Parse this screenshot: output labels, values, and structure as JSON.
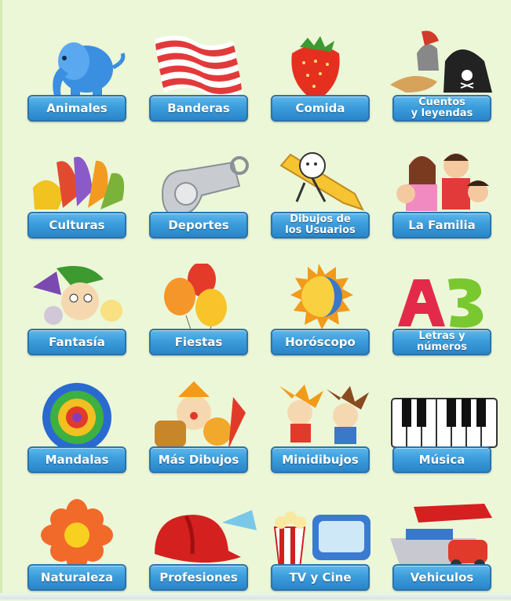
{
  "categories": [
    {
      "label": "Animales",
      "icon": "elephant-icon"
    },
    {
      "label": "Banderas",
      "icon": "flag-icon"
    },
    {
      "label": "Comida",
      "icon": "strawberry-icon"
    },
    {
      "label": "Cuentos\ny leyendas",
      "icon": "pirate-hat-icon"
    },
    {
      "label": "Culturas",
      "icon": "hands-icon"
    },
    {
      "label": "Deportes",
      "icon": "whistle-icon"
    },
    {
      "label": "Dibujos de\nlos Usuarios",
      "icon": "pencil-character-icon"
    },
    {
      "label": "La Familia",
      "icon": "family-icon"
    },
    {
      "label": "Fantasía",
      "icon": "elf-icon"
    },
    {
      "label": "Fiestas",
      "icon": "balloons-icon"
    },
    {
      "label": "Horóscopo",
      "icon": "sun-moon-icon"
    },
    {
      "label": "Letras y\nnúmeros",
      "icon": "letters-numbers-icon"
    },
    {
      "label": "Mandalas",
      "icon": "mandala-icon"
    },
    {
      "label": "Más Dibujos",
      "icon": "clown-icon"
    },
    {
      "label": "Minidibujos",
      "icon": "kids-icon"
    },
    {
      "label": "Música",
      "icon": "piano-icon"
    },
    {
      "label": "Naturaleza",
      "icon": "flower-icon"
    },
    {
      "label": "Profesiones",
      "icon": "firefighter-helmet-icon"
    },
    {
      "label": "TV y Cine",
      "icon": "popcorn-tv-icon"
    },
    {
      "label": "Vehiculos",
      "icon": "vehicles-icon"
    }
  ],
  "colors": {
    "background": "#ecf7d8",
    "button": "#3c9ddc",
    "button_border": "#2b73ab",
    "button_text": "#ffffff"
  }
}
